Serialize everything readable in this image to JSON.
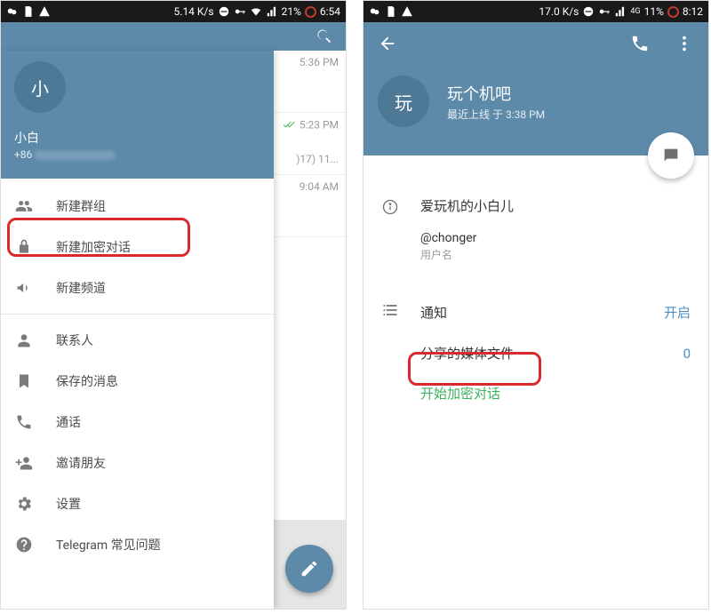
{
  "left": {
    "status": {
      "speed": "5.14 K/s",
      "battery": "21%",
      "time": "6:54"
    },
    "drawer": {
      "avatar_initial": "小",
      "name": "小白",
      "phone_prefix": "+86",
      "menu": {
        "new_group": "新建群组",
        "new_secret_chat": "新建加密对话",
        "new_channel": "新建频道",
        "contacts": "联系人",
        "saved_messages": "保存的消息",
        "calls": "通话",
        "invite_friends": "邀请朋友",
        "settings": "设置",
        "faq": "Telegram 常见问题"
      }
    },
    "chat_previews": {
      "row1_time": "5:36 PM",
      "row2_time": "5:23 PM",
      "row2_preview": ")17) 11...",
      "row3_time": "9:04 AM"
    }
  },
  "right": {
    "status": {
      "speed": "17.0 K/s",
      "net": "4G",
      "battery": "11%",
      "time": "8:12"
    },
    "avatar_initial": "玩",
    "name": "玩个机吧",
    "last_seen": "最近上线 于 3:38 PM",
    "info": {
      "display_name": "爱玩机的小白儿",
      "username": "@chonger",
      "username_label": "用户名"
    },
    "settings": {
      "notifications_label": "通知",
      "notifications_value": "开启",
      "shared_media_label": "分享的媒体文件",
      "shared_media_value": "0",
      "start_secret_chat": "开始加密对话"
    }
  }
}
